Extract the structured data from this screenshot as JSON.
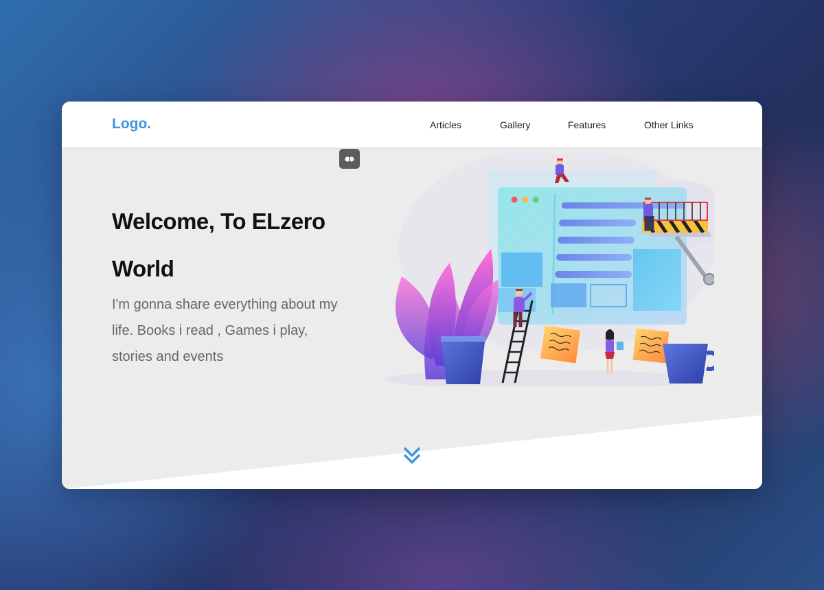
{
  "header": {
    "logo": "Logo.",
    "nav": [
      "Articles",
      "Gallery",
      "Features",
      "Other Links"
    ]
  },
  "hero": {
    "title_line1": "Welcome, To ELzero",
    "title_line2": "World",
    "subtitle": "I'm gonna share everything about my life. Books i read , Games i play, stories and events"
  },
  "icons": {
    "toggle": "bullets-toggle-icon",
    "scroll": "double-chevron-down-icon"
  },
  "colors": {
    "accent": "#3d94e0",
    "hero_bg": "#ececec",
    "header_bg": "#ffffff",
    "toggle_bg": "#5c5c5c"
  }
}
